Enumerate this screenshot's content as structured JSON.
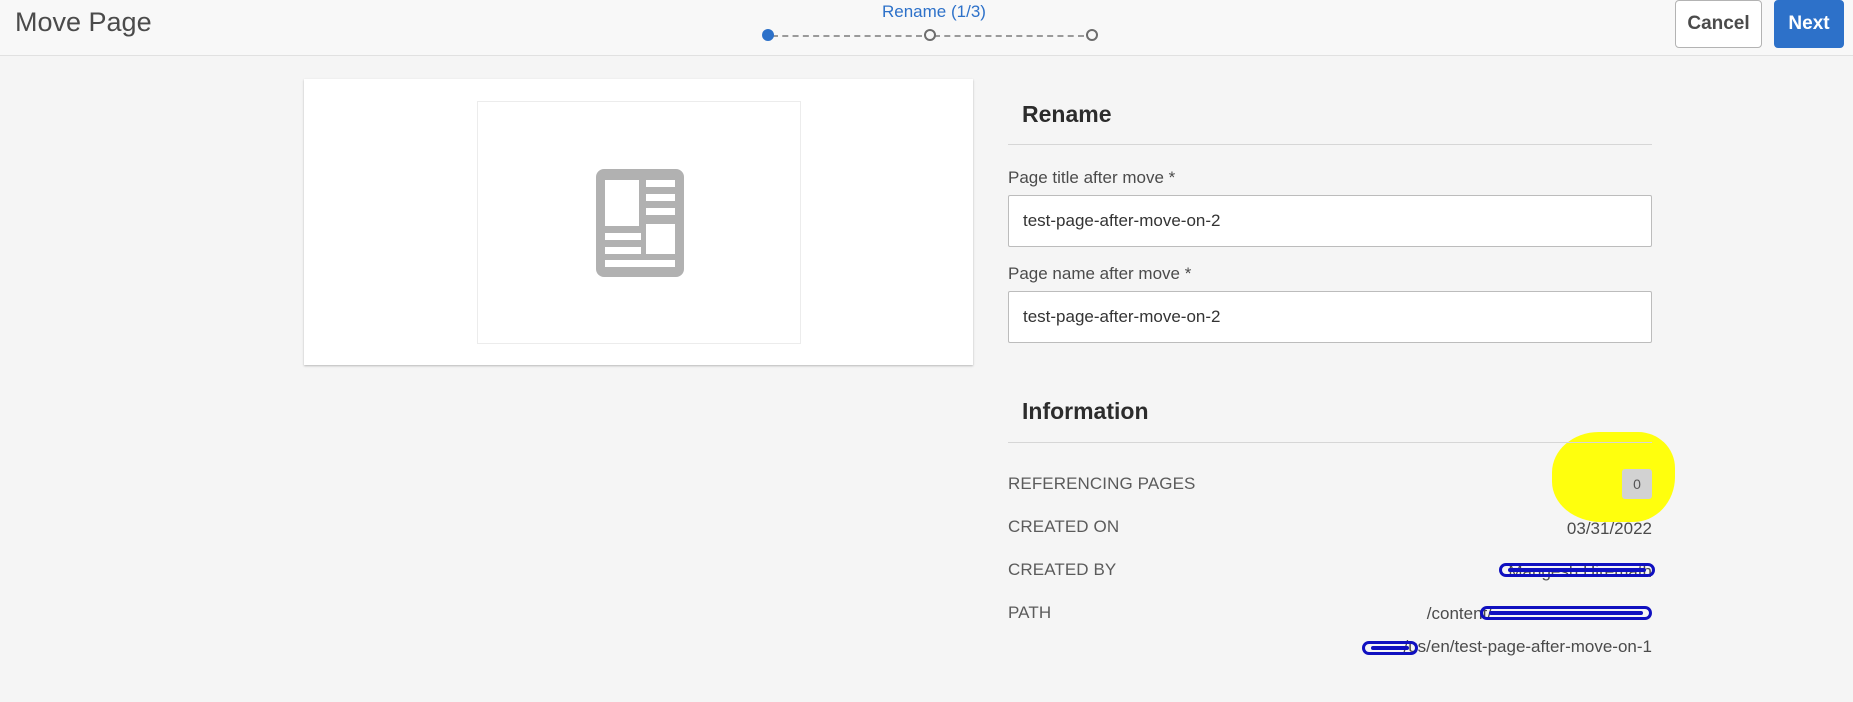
{
  "header": {
    "title": "Move Page",
    "step_label": "Rename (1/3)",
    "cancel_label": "Cancel",
    "next_label": "Next"
  },
  "form": {
    "rename_heading": "Rename",
    "title_label": "Page title after move *",
    "title_value": "test-page-after-move-on-2",
    "name_label": "Page name after move *",
    "name_value": "test-page-after-move-on-2"
  },
  "info": {
    "heading": "Information",
    "referencing_label": "REFERENCING PAGES",
    "referencing_value": "0",
    "created_on_label": "CREATED ON",
    "created_on_value": "03/31/2022",
    "created_by_label": "CREATED BY",
    "created_by_value": "Mangesh Hiremath",
    "path_label": "PATH",
    "path_line1": "/content/",
    "path_line2": "/us/en/test-page-after-move-on-1"
  },
  "icons": {
    "page": "page-document-icon"
  },
  "colors": {
    "accent": "#2d71c9",
    "highlight": "#ffff00",
    "redaction": "#1010c0"
  }
}
